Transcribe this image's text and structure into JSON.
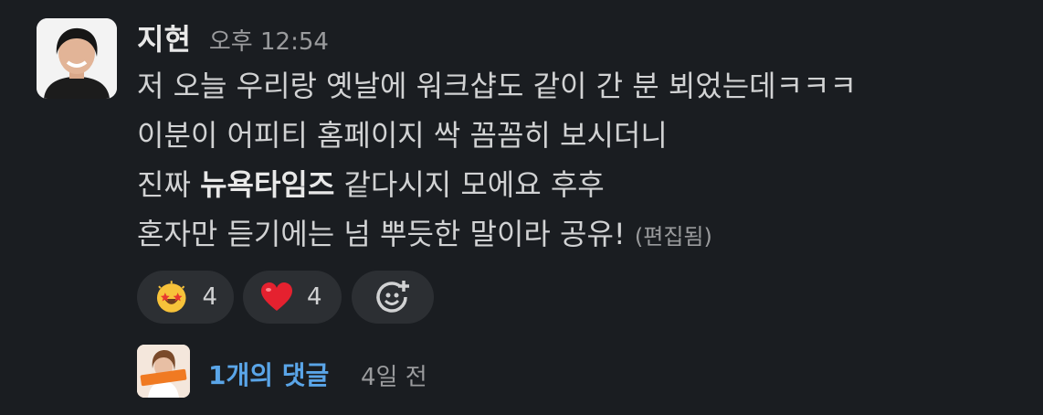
{
  "message": {
    "sender": "지현",
    "time": "오후 12:54",
    "lines": [
      "저 오늘 우리랑 옛날에 워크샵도 같이 간 분 뵈었는데ㅋㅋㅋ",
      "이분이 어피티 홈페이지 싹 꼼꼼히 보시더니"
    ],
    "line3_pre": "진짜 ",
    "line3_bold": "뉴욕타임즈",
    "line3_post": " 같다시지 모에요 후후",
    "line4": "혼자만 듣기에는 넘 뿌듯한 말이라 공유!",
    "edited": "(편집됨)"
  },
  "reactions": [
    {
      "icon": "star-struck-emoji",
      "count": "4"
    },
    {
      "icon": "red-heart-emoji",
      "count": "4"
    }
  ],
  "add_reaction_icon": "add-reaction-icon",
  "thread": {
    "replies": "1개의 댓글",
    "time": "4일 전"
  },
  "colors": {
    "background": "#1a1d21",
    "reaction_bg": "#2c2f33",
    "link": "#5aa5e8"
  }
}
